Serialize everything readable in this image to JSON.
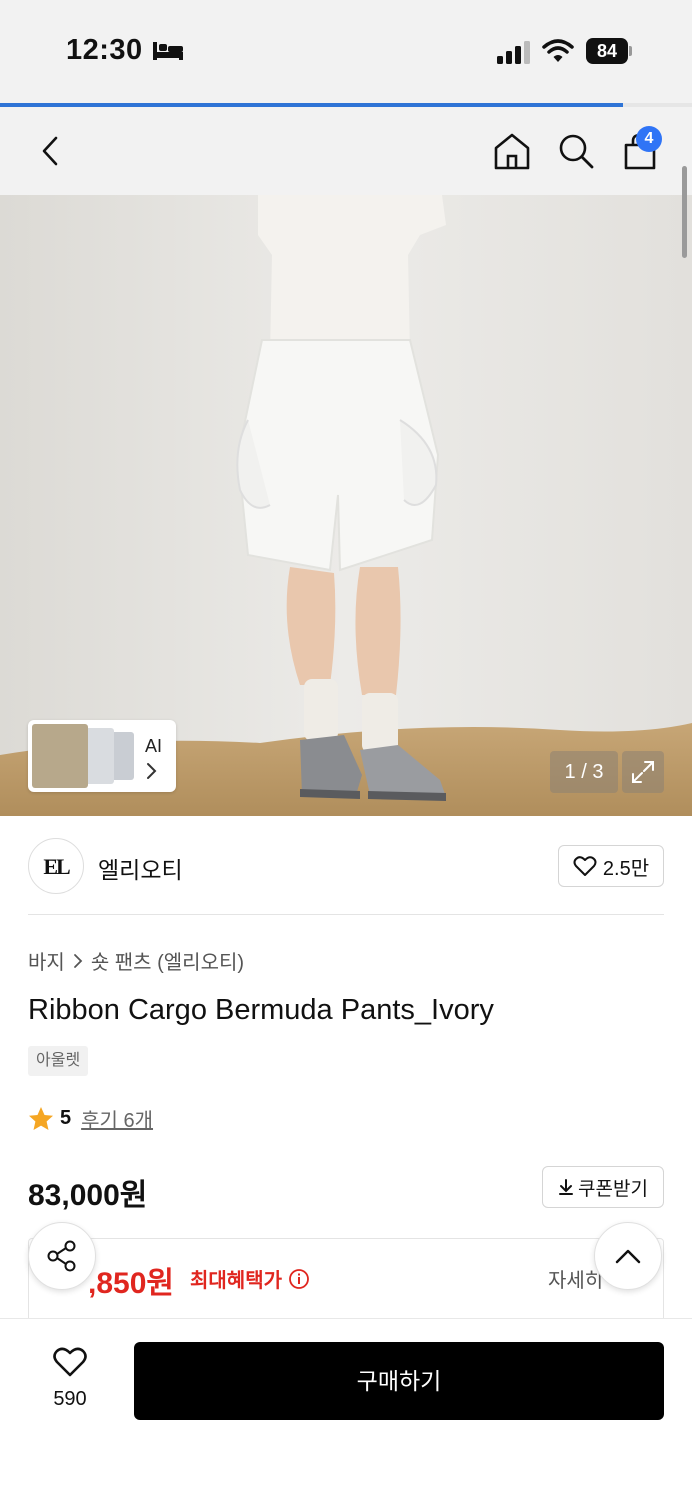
{
  "status_bar": {
    "time": "12:30",
    "battery": "84",
    "icons": [
      "bed-icon",
      "cellular-signal-icon",
      "wifi-icon",
      "battery-icon"
    ]
  },
  "page_load_progress_percent": 90,
  "header": {
    "icons": [
      "back-arrow-icon",
      "home-icon",
      "search-icon",
      "shopping-bag-icon"
    ],
    "cart_badge": "4"
  },
  "gallery": {
    "ai_label": "AI",
    "page_counter": "1 / 3",
    "icons": [
      "chevron-right-icon",
      "expand-icon"
    ]
  },
  "brand": {
    "logo_text": "EL",
    "name": "엘리오티",
    "like_count": "2.5만"
  },
  "product": {
    "breadcrumb": [
      "바지",
      "숏 팬츠 (엘리오티)"
    ],
    "title": "Ribbon Cargo Bermuda Pants_Ivory",
    "tag": "아울렛",
    "rating": "5",
    "review_link": "후기 6개",
    "price": "83,000원",
    "coupon_label": "쿠폰받기",
    "benefit_price": ",850원",
    "benefit_label": "최대혜택가",
    "benefit_detail": "자세히"
  },
  "bottom_bar": {
    "wish_count": "590",
    "buy_label": "구매하기"
  },
  "colors": {
    "accent_blue": "#2f74f6",
    "benefit_red": "#e0261f",
    "rating_star": "#f5a623",
    "buy_button": "#000000"
  }
}
